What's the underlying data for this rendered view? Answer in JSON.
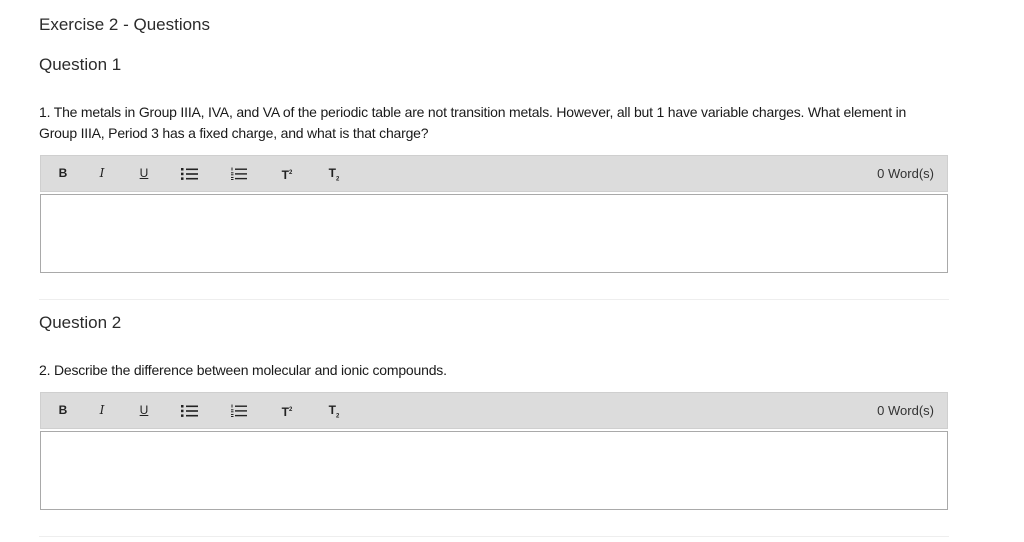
{
  "page": {
    "title": "Exercise 2 - Questions"
  },
  "questions": [
    {
      "heading": "Question 1",
      "text": "1. The metals in Group IIIA, IVA, and VA of the periodic table are not transition metals. However, all but 1 have variable charges. What element in Group IIIA, Period 3 has a fixed charge, and what is that charge?",
      "toolbar": {
        "bold": "B",
        "italic": "I",
        "underline": "U",
        "superscript": "T",
        "subscript": "T",
        "word_count": "0 Word(s)"
      },
      "answer": ""
    },
    {
      "heading": "Question 2",
      "text": "2. Describe the difference between molecular and ionic compounds.",
      "toolbar": {
        "bold": "B",
        "italic": "I",
        "underline": "U",
        "superscript": "T",
        "subscript": "T",
        "word_count": "0 Word(s)"
      },
      "answer": ""
    }
  ],
  "icons": {
    "bullet_list": "bullet-list-icon",
    "numbered_list": "numbered-list-icon"
  },
  "colors": {
    "toolbar_bg": "#dcdcdc",
    "answer_border": "#a9a9a9",
    "divider": "#eeeeee"
  }
}
